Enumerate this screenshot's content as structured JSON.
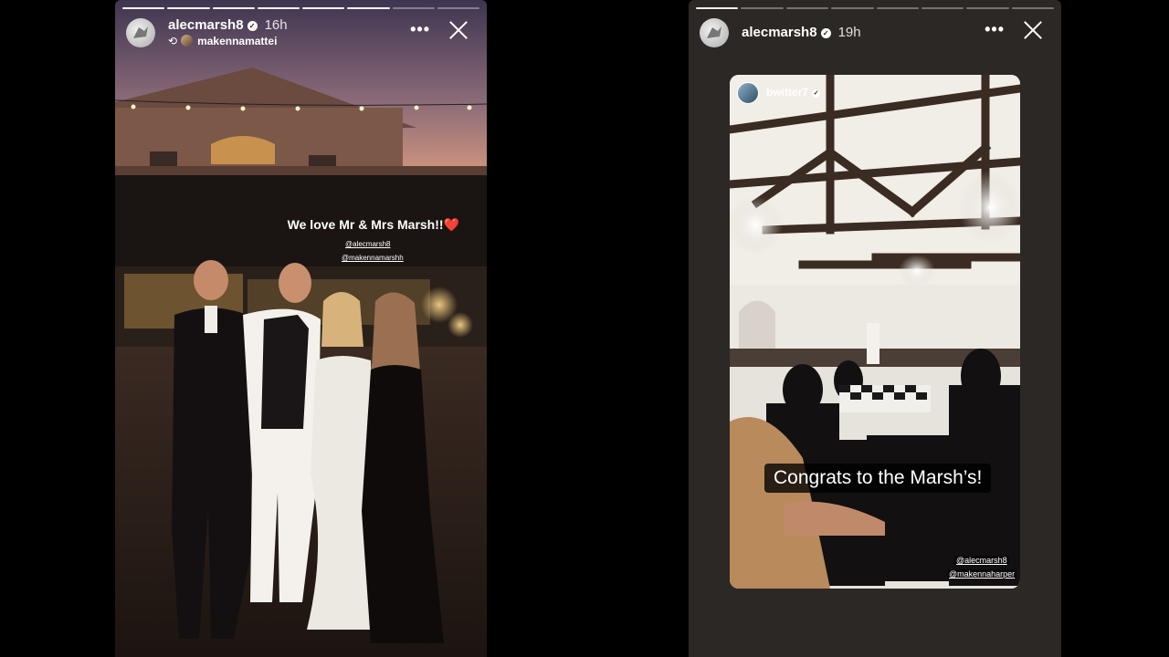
{
  "stories": [
    {
      "username": "alecmarsh8",
      "time": "16h",
      "reposted_from": "makennamattei",
      "caption": "We love Mr & Mrs Marsh!!",
      "caption_emoji": "❤️",
      "mentions": [
        "@alecmarsh8",
        "@makennamarshh"
      ],
      "progress_segments": 8,
      "progress_done": 6
    },
    {
      "username": "alecmarsh8",
      "time": "19h",
      "inner_username": "bwitter7",
      "caption": "Congrats to the Marsh’s!",
      "mentions": [
        "@alecmarsh8",
        "@makennaharper"
      ],
      "progress_segments": 8,
      "progress_done": 1
    }
  ],
  "icons": {
    "more": "more-options-icon",
    "close": "close-icon",
    "verified": "verified-badge-icon",
    "repost": "repost-icon"
  },
  "colors": {
    "right_background": "#2c2825",
    "page_background": "#000000"
  }
}
